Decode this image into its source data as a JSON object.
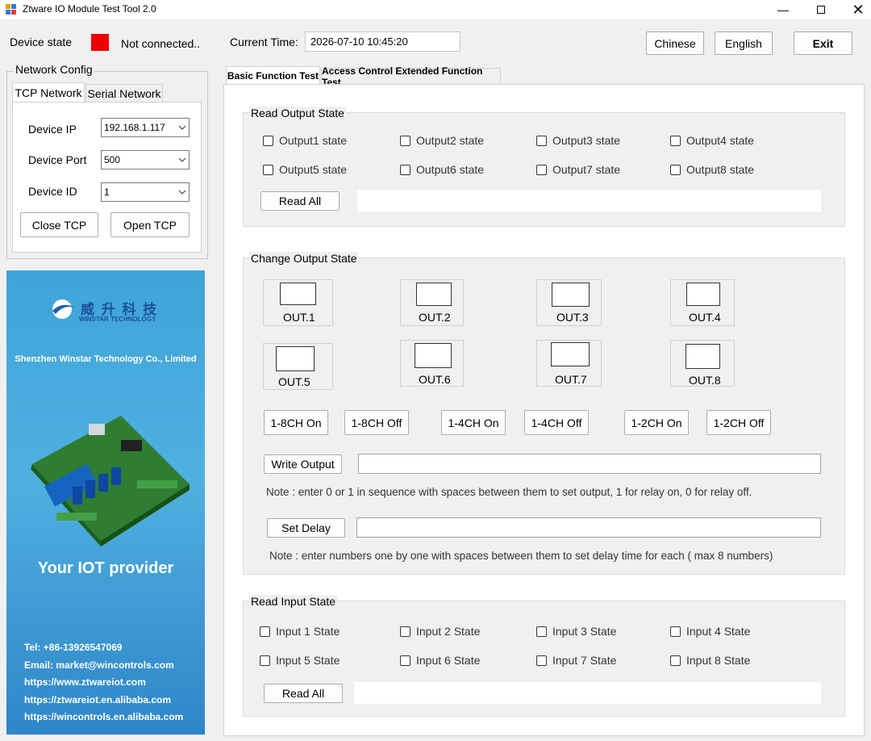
{
  "window": {
    "title": "Ztware IO Module Test Tool 2.0"
  },
  "header": {
    "device_state_label": "Device state",
    "device_state_color": "#ee0000",
    "connection_status": "Not connected..",
    "current_time_label": "Current Time:",
    "current_time_value": "2026-07-10 10:45:20",
    "chinese_label": "Chinese",
    "english_label": "English",
    "exit_label": "Exit"
  },
  "network": {
    "group_title": "Network Config",
    "tabs": [
      "TCP Network",
      "Serial Network"
    ],
    "ip_label": "Device IP",
    "ip_value": "192.168.1.117",
    "port_label": "Device Port",
    "port_value": "500",
    "id_label": "Device ID",
    "id_value": "1",
    "close_label": "Close TCP",
    "open_label": "Open TCP"
  },
  "ad": {
    "logo_cn": "威 升 科 技",
    "logo_en": "WINSTAR TECHNOLOGY",
    "company": "Shenzhen Winstar Technology Co., Limited",
    "slogan": "Your IOT provider",
    "contacts": [
      "Tel: +86-13926547069",
      "Email: market@wincontrols.com",
      "https://www.ztwareiot.com",
      "https://ztwareiot.en.alibaba.com",
      "https://wincontrols.en.alibaba.com"
    ]
  },
  "tabs": [
    "Basic Function Test",
    "Access Control Extended Function Test"
  ],
  "read_output": {
    "title": "Read Output State",
    "items": [
      "Output1 state",
      "Output2 state",
      "Output3 state",
      "Output4 state",
      "Output5 state",
      "Output6 state",
      "Output7 state",
      "Output8 state"
    ],
    "read_all_label": "Read All",
    "result": ""
  },
  "change_output": {
    "title": "Change Output State",
    "outputs": [
      "OUT.1",
      "OUT.2",
      "OUT.3",
      "OUT.4",
      "OUT.5",
      "OUT.6",
      "OUT.7",
      "OUT.8"
    ],
    "channel_buttons": [
      "1-8CH On",
      "1-8CH Off",
      "1-4CH On",
      "1-4CH Off",
      "1-2CH On",
      "1-2CH Off"
    ],
    "write_label": "Write Output",
    "write_value": "",
    "note1": "Note :  enter 0 or 1 in sequence with spaces between them to set output, 1 for relay on, 0 for relay off.",
    "delay_label": "Set Delay",
    "delay_value": "",
    "note2": "Note :  enter numbers one by one with spaces between them to set delay time for each ( max 8 numbers)"
  },
  "read_input": {
    "title": "Read Input State",
    "items": [
      "Input 1 State",
      "Input 2 State",
      "Input 3 State",
      "Input 4 State",
      "Input 5 State",
      "Input 6 State",
      "Input 7 State",
      "Input 8 State"
    ],
    "read_all_label": "Read All",
    "result": ""
  }
}
